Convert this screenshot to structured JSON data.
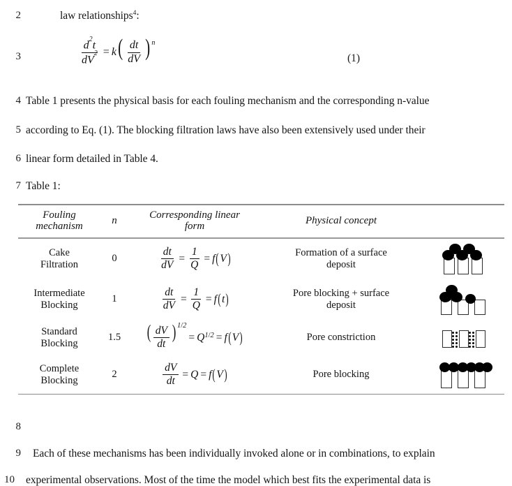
{
  "document": {
    "line_numbers": [
      "2",
      "3",
      "4",
      "5",
      "6",
      "7",
      "8",
      "9",
      "10"
    ],
    "lines": {
      "l2_text_before_sup": "law relationships",
      "l2_sup": "4",
      "l2_text_after_sup": ":",
      "l3_equation_number": "(1)",
      "l4": "Table 1 presents the physical basis for each fouling mechanism and the corresponding n-value",
      "l5": "according to Eq. (1).  The blocking filtration laws have also been extensively used under their",
      "l6": "linear form detailed in Table 4.",
      "l7": "Table 1:",
      "l9": "Each of these mechanisms has been individually invoked alone or in combinations, to explain",
      "l10": "experimental observations. Most of the time the model which best fits the experimental data is"
    },
    "display_equation": {
      "lhs_num_d": "d",
      "lhs_num_exp": "2",
      "lhs_num_t": "t",
      "lhs_den_dV": "dV",
      "lhs_den_exp": "2",
      "equals": "=",
      "k": "k",
      "inner_num": "dt",
      "inner_den": "dV",
      "exponent": "n"
    }
  },
  "table": {
    "caption": "Table 1:",
    "headers": {
      "mechanism": "Fouling mechanism",
      "mechanism_line1": "Fouling",
      "mechanism_line2": "mechanism",
      "n": "n",
      "linear_form": "Corresponding linear form",
      "linear_form_line1": "Corresponding linear",
      "linear_form_line2": "form",
      "physical_concept": "Physical concept",
      "diagram": ""
    },
    "rows": [
      {
        "mechanism_line1": "Cake",
        "mechanism_line2": "Filtration",
        "n": "0",
        "equation_text": "dt/dV = 1/Q = f(V)",
        "equation": {
          "num1": "dt",
          "den1": "dV",
          "eq1": "=",
          "num2": "1",
          "den2": "Q",
          "eq2": "=",
          "fn": "f",
          "arg": "V"
        },
        "physical_concept_line1": "Formation of a surface",
        "physical_concept_line2": "deposit",
        "diagram_name": "cake-filtration-diagram"
      },
      {
        "mechanism_line1": "Intermediate",
        "mechanism_line2": "Blocking",
        "n": "1",
        "equation_text": "dt/dV = 1/Q = f(t)",
        "equation": {
          "num1": "dt",
          "den1": "dV",
          "eq1": "=",
          "num2": "1",
          "den2": "Q",
          "eq2": "=",
          "fn": "f",
          "arg": "t"
        },
        "physical_concept_line1": "Pore blocking + surface",
        "physical_concept_line2": "deposit",
        "diagram_name": "intermediate-blocking-diagram"
      },
      {
        "mechanism_line1": "Standard",
        "mechanism_line2": "Blocking",
        "n": "1.5",
        "equation_text": "(dV/dt)^(1/2) = Q^(1/2) = f(V)",
        "equation": {
          "num1": "dV",
          "den1": "dt",
          "exp_num": "1",
          "exp_slash": "/",
          "exp_den": "2",
          "eq1": "=",
          "q": "Q",
          "eq2": "=",
          "fn": "f",
          "arg": "V"
        },
        "physical_concept_line1": "Pore constriction",
        "physical_concept_line2": "",
        "diagram_name": "pore-constriction-diagram"
      },
      {
        "mechanism_line1": "Complete",
        "mechanism_line2": "Blocking",
        "n": "2",
        "equation_text": "dV/dt = Q = f(V)",
        "equation": {
          "num1": "dV",
          "den1": "dt",
          "eq1": "=",
          "q": "Q",
          "eq2": "=",
          "fn": "f",
          "arg": "V"
        },
        "physical_concept_line1": "Pore blocking",
        "physical_concept_line2": "",
        "diagram_name": "complete-blocking-diagram"
      }
    ]
  },
  "colors": {
    "text": "#141414",
    "rule": "#8c8c8c",
    "diagram_stroke": "#2b2b2b",
    "diagram_fill": "#000000",
    "page_bg": "#ffffff"
  }
}
